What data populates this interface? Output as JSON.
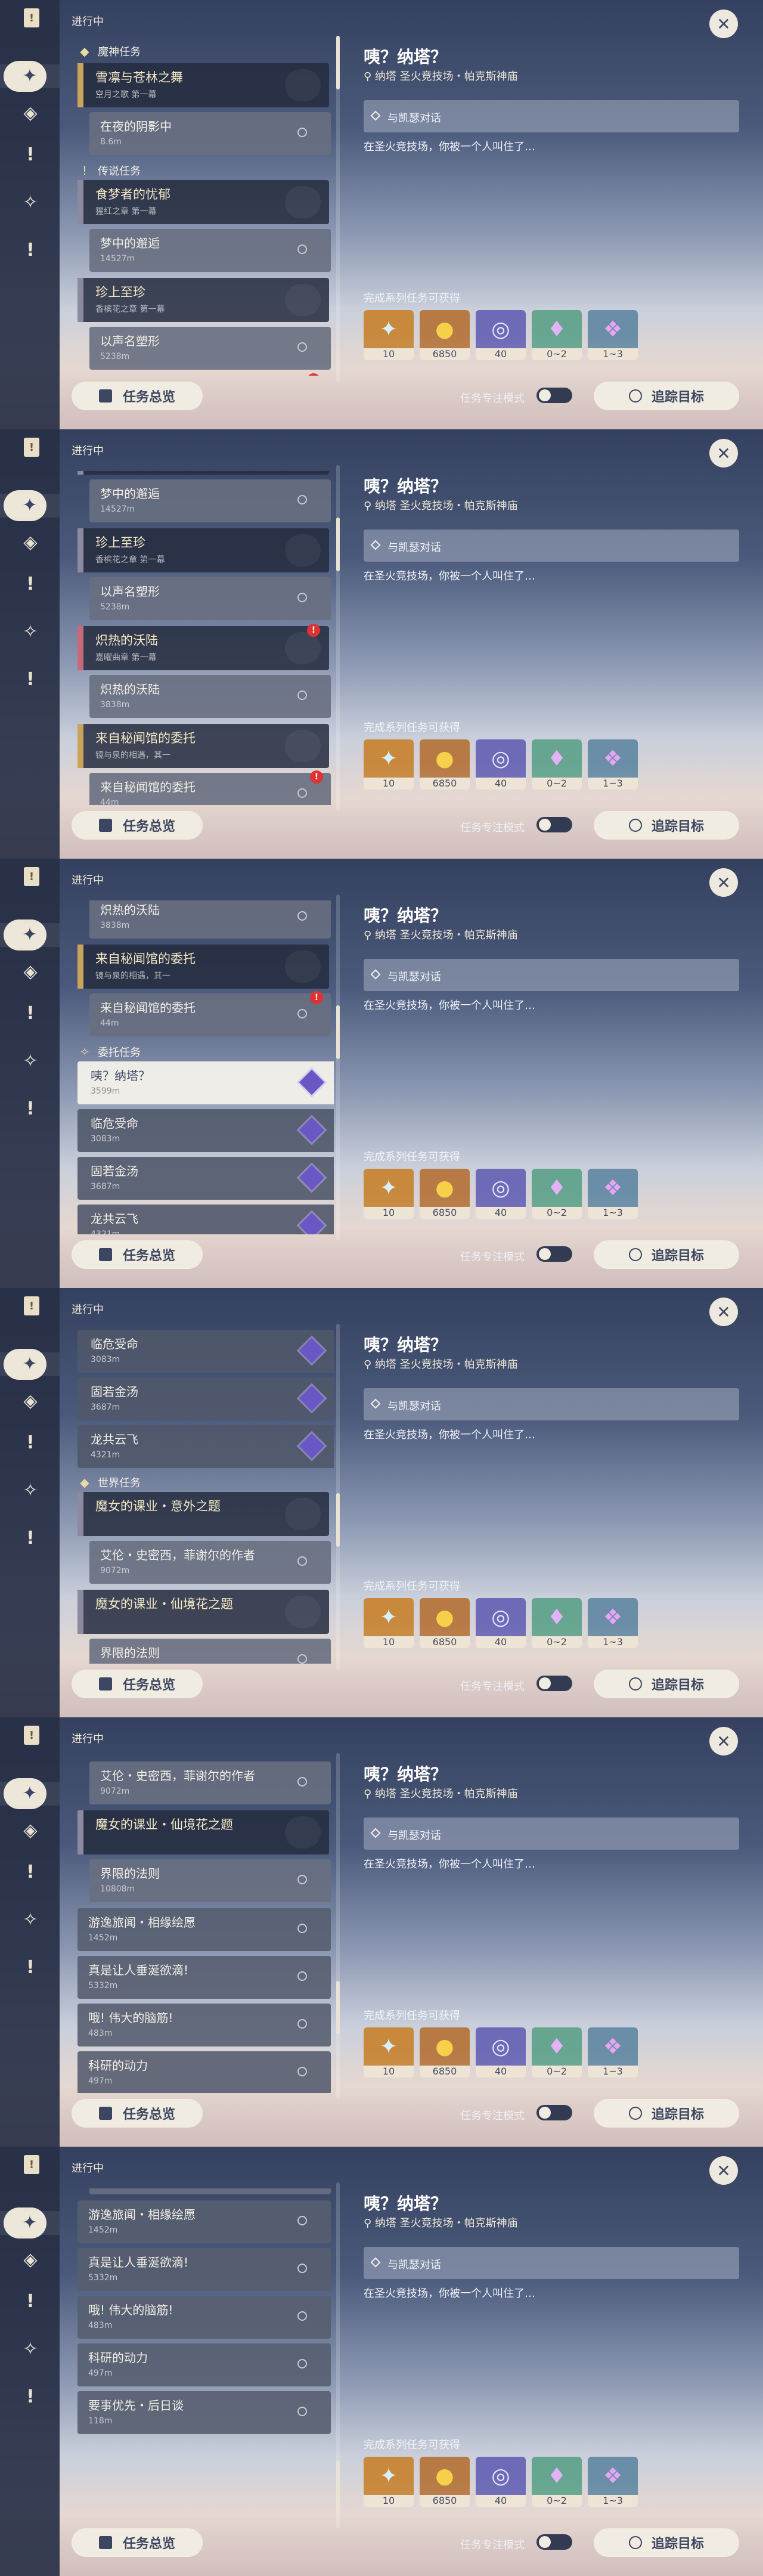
{
  "rail": {
    "icons": [
      "quest-book-icon",
      "diamond-cross-icon",
      "compass-diamond-icon",
      "alert-diamond-icon",
      "star-gem-icon",
      "exclamation-icon"
    ]
  },
  "list_title": "进行中",
  "sections": {
    "archon": "魔神任务",
    "legend": "传说任务",
    "commission": "委托任务",
    "world": "世界任务"
  },
  "quests": {
    "q1": {
      "name": "雪凛与苍林之舞",
      "sub": "空月之歌 第一幕"
    },
    "q1_step": {
      "name": "在夜的阴影中",
      "dist": "8.6m"
    },
    "q2": {
      "name": "食梦者的忧郁",
      "sub": "猩红之章 第一幕"
    },
    "q2_step": {
      "name": "梦中的邂逅",
      "dist": "14527m"
    },
    "q3": {
      "name": "珍上至珍",
      "sub": "香槟花之章 第一幕"
    },
    "q3_step": {
      "name": "以声名塑形",
      "dist": "5238m"
    },
    "q4": {
      "name": "炽热的沃陆",
      "sub": "嘉曜曲章 第一幕"
    },
    "q4_step": {
      "name": "炽热的沃陆",
      "dist": "3838m"
    },
    "q5": {
      "name": "来自秘闻馆的委托",
      "sub": "镜与泉的相遇，其一"
    },
    "q5_step": {
      "name": "来自秘闻馆的委托",
      "dist": "44m"
    },
    "q6": {
      "name": "魔女的课业・意外之题"
    },
    "q6_step": {
      "name": "艾伦・史密西，菲谢尔的作者",
      "dist": "9072m"
    },
    "q7": {
      "name": "魔女的课业・仙境花之题"
    },
    "q7_step": {
      "name": "界限的法则",
      "dist": "10808m"
    },
    "w1": {
      "name": "游逸旅闻・相缘绘愿",
      "dist": "1452m"
    },
    "w2": {
      "name": "真是让人垂涎欲滴!",
      "dist": "5332m"
    },
    "w3": {
      "name": "哦! 伟大的脑筋!",
      "dist": "483m"
    },
    "w4": {
      "name": "科研的动力",
      "dist": "497m"
    },
    "w5": {
      "name": "要事优先・后日谈",
      "dist": "118m"
    }
  },
  "commissions": [
    {
      "name": "咦？纳塔？",
      "dist": "3599m"
    },
    {
      "name": "临危受命",
      "dist": "3083m"
    },
    {
      "name": "固若金汤",
      "dist": "3687m"
    },
    {
      "name": "龙共云飞",
      "dist": "4321m"
    }
  ],
  "details": {
    "title": "咦？纳塔？",
    "location": "纳塔 圣火竞技场・帕克斯神庙",
    "objective": "与凯瑟对话",
    "description": "在圣火竞技场，你被一个人叫住了…",
    "reward_label": "完成系列任务可获得",
    "rewards": [
      {
        "icon": "adventure-exp-icon",
        "qty": "10"
      },
      {
        "icon": "mora-coin-icon",
        "qty": "6850"
      },
      {
        "icon": "companionship-exp-icon",
        "qty": "40"
      },
      {
        "icon": "crystal-chunk-icon",
        "qty": "0~2"
      },
      {
        "icon": "crystal-cluster-icon",
        "qty": "1~3"
      }
    ]
  },
  "bottom": {
    "overview_label": "任务总览",
    "focus_label": "任务专注模式",
    "track_label": "追踪目标"
  },
  "scroll_fraction": [
    0.0,
    0.18,
    0.38,
    0.58,
    0.78,
    0.95
  ]
}
